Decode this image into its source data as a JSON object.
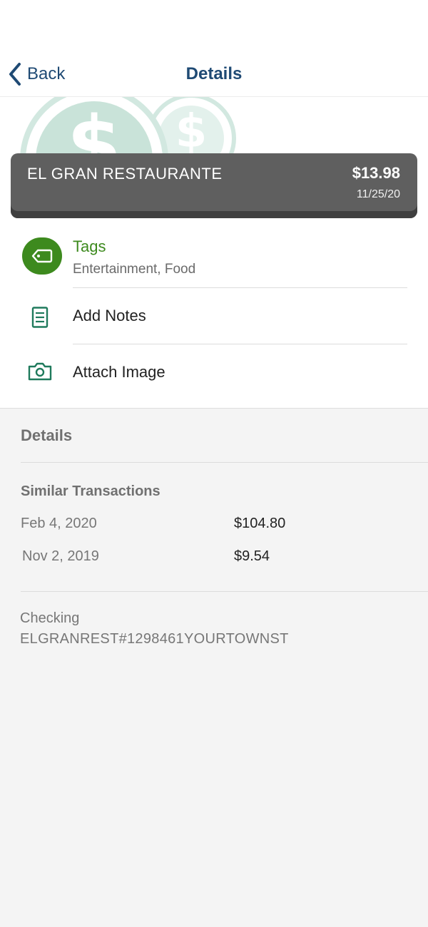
{
  "nav": {
    "back_label": "Back",
    "title": "Details"
  },
  "transaction": {
    "merchant": "EL GRAN RESTAURANTE",
    "amount": "$13.98",
    "date": "11/25/20"
  },
  "actions": {
    "tags": {
      "title": "Tags",
      "value": "Entertainment, Food",
      "icon": "tag-icon"
    },
    "notes": {
      "label": "Add Notes",
      "icon": "notes-icon"
    },
    "image": {
      "label": "Attach Image",
      "icon": "camera-icon"
    }
  },
  "details": {
    "header": "Details",
    "similar_title": "Similar Transactions",
    "similar": [
      {
        "date": "Feb 4, 2020",
        "amount": "$104.80"
      },
      {
        "date": "Nov 2, 2019",
        "amount": "$9.54"
      }
    ],
    "account": "Checking",
    "description": "ELGRANREST#1298461YOURTOWNST"
  },
  "colors": {
    "nav_text": "#1f4a74",
    "accent_green": "#3d8a1e",
    "icon_teal": "#1f7a5c",
    "card_bg": "#5f5f5f",
    "page_bg": "#f4f4f4"
  }
}
